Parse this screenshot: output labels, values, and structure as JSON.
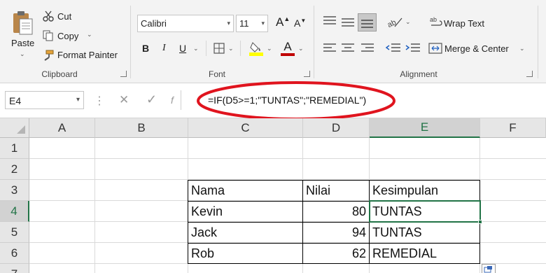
{
  "clipboard": {
    "paste": "Paste",
    "cut": "Cut",
    "copy": "Copy",
    "format_painter": "Format Painter",
    "group_label": "Clipboard"
  },
  "font": {
    "font_name": "Calibri",
    "font_size": "11",
    "bold": "B",
    "italic": "I",
    "underline": "U",
    "grow": "A",
    "shrink": "A",
    "font_color_letter": "A",
    "group_label": "Font"
  },
  "alignment": {
    "wrap_text": "Wrap Text",
    "merge_center": "Merge & Center",
    "group_label": "Alignment"
  },
  "colors": {
    "accent_green": "#217346",
    "highlight_yellow": "#ffff00",
    "font_red": "#c00000",
    "annotation_red": "#e0141e"
  },
  "formula_bar": {
    "name_box": "E4",
    "cancel": "✕",
    "enter": "✓",
    "formula": "=IF(D5>=1;\"TUNTAS\";\"REMEDIAL\")"
  },
  "sheet": {
    "columns": [
      "A",
      "B",
      "C",
      "D",
      "E",
      "F"
    ],
    "rows": [
      "1",
      "2",
      "3",
      "4",
      "5",
      "6",
      "7"
    ],
    "table_header": {
      "c": "Nama",
      "d": "Nilai",
      "e": "Kesimpulan"
    },
    "table_rows": [
      {
        "c": "Kevin",
        "d": "80",
        "e": "TUNTAS"
      },
      {
        "c": "Jack",
        "d": "94",
        "e": "TUNTAS"
      },
      {
        "c": "Rob",
        "d": "62",
        "e": "REMEDIAL"
      }
    ],
    "active_cell": "E4"
  }
}
